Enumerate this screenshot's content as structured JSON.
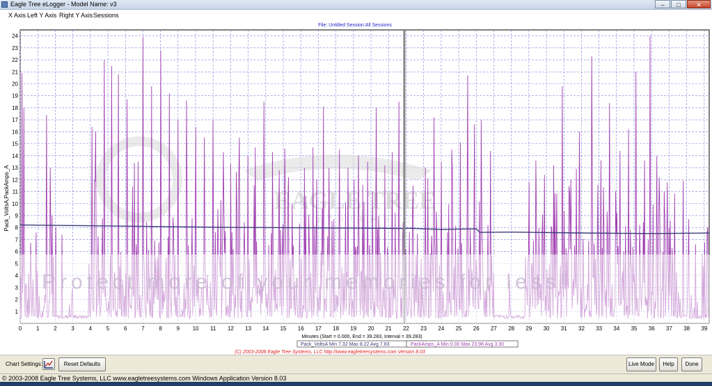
{
  "window": {
    "title": "Eagle Tree eLogger - Model Name: v3",
    "minimize": "–",
    "maximize": "□",
    "close": "✕"
  },
  "menu": [
    "X Axis",
    "Left Y Axis",
    "Right Y Axis",
    "Sessions"
  ],
  "header": {
    "file_session": "File: Untitled   Session:All Sessions"
  },
  "chart_data": {
    "type": "line",
    "ylabel": "Pack_VoltsA,PackAmps_A",
    "xlabel": "Minutes (Start = 0.000,  End = 39.283,  Interval = 39.283)",
    "x_ticks": [
      "0",
      "1",
      "2",
      "3",
      "4",
      "5",
      "6",
      "7",
      "8",
      "9",
      "10",
      "11",
      "12",
      "13",
      "14",
      "15",
      "16",
      "17",
      "18",
      "19",
      "20",
      "21",
      "22",
      "23",
      "24",
      "25",
      "26",
      "27",
      "28",
      "29",
      "30",
      "31",
      "32",
      "33",
      "34",
      "35",
      "36",
      "37",
      "38",
      "39"
    ],
    "y_ticks": [
      "1",
      "2",
      "3",
      "4",
      "5",
      "6",
      "7",
      "8",
      "9",
      "10",
      "11",
      "12",
      "13",
      "14",
      "15",
      "16",
      "17",
      "18",
      "19",
      "20",
      "21",
      "22",
      "23",
      "24"
    ],
    "xlim": [
      0,
      39.283
    ],
    "ylim": [
      0,
      24.5
    ],
    "marker_x": 21.9,
    "series": [
      {
        "name": "Pack_VoltsA",
        "color": "#3b3b7a",
        "min": "7.32",
        "max": "8.22",
        "avg": "7.83",
        "x": [
          0,
          4,
          8,
          12,
          16,
          20,
          21.9,
          22,
          24,
          26,
          26.2,
          28,
          32,
          36,
          39.283
        ],
        "values": [
          8.22,
          8.15,
          8.08,
          8.02,
          7.98,
          7.95,
          7.92,
          7.95,
          7.85,
          7.9,
          7.6,
          7.62,
          7.55,
          7.5,
          7.55
        ]
      },
      {
        "name": "PackAmps_A",
        "color": "#a040b0",
        "min": "0.00",
        "max": "23.96",
        "avg": "3.30",
        "peaks": [
          [
            0.1,
            20.9
          ],
          [
            0.2,
            18
          ],
          [
            1.5,
            17.4
          ],
          [
            1.7,
            13
          ],
          [
            4.1,
            16.4
          ],
          [
            4.3,
            16
          ],
          [
            4.8,
            22
          ],
          [
            5.2,
            21.5
          ],
          [
            5.6,
            20.8
          ],
          [
            6.1,
            18.7
          ],
          [
            6.5,
            13.4
          ],
          [
            7,
            23.9
          ],
          [
            7.5,
            19.8
          ],
          [
            8,
            22.8
          ],
          [
            8.5,
            19.2
          ],
          [
            9,
            17
          ],
          [
            9.5,
            18.6
          ],
          [
            10,
            16.4
          ],
          [
            10.5,
            15.5
          ],
          [
            11,
            17
          ],
          [
            11.6,
            14.3
          ],
          [
            12,
            13.3
          ],
          [
            12.5,
            15.5
          ],
          [
            13,
            14
          ],
          [
            13.4,
            14.7
          ],
          [
            13.9,
            18.5
          ],
          [
            14.4,
            14.3
          ],
          [
            15.1,
            14.6
          ],
          [
            15.5,
            10
          ],
          [
            16.2,
            13
          ],
          [
            16.7,
            14.7
          ],
          [
            17.3,
            18.1
          ],
          [
            17.6,
            13
          ],
          [
            18.2,
            14.5
          ],
          [
            18.7,
            13
          ],
          [
            19.3,
            14
          ],
          [
            19.8,
            13.5
          ],
          [
            20.3,
            18
          ],
          [
            20.8,
            13.2
          ],
          [
            21.2,
            14.3
          ],
          [
            21.6,
            18.5
          ],
          [
            22.4,
            11.5
          ],
          [
            23.1,
            13
          ],
          [
            23.6,
            17.2
          ],
          [
            24,
            13.5
          ],
          [
            24.6,
            14.5
          ],
          [
            25.1,
            15.1
          ],
          [
            25.5,
            20.7
          ],
          [
            25.9,
            16.6
          ],
          [
            26.3,
            17
          ],
          [
            26.8,
            14.4
          ],
          [
            29,
            11.8
          ],
          [
            29.4,
            13.6
          ],
          [
            29.9,
            12.4
          ],
          [
            30.4,
            13.2
          ],
          [
            30.9,
            19.8
          ],
          [
            31.4,
            12
          ],
          [
            31.9,
            16
          ],
          [
            32.6,
            22.3
          ],
          [
            33.1,
            13.6
          ],
          [
            33.6,
            18.4
          ],
          [
            34.2,
            14.4
          ],
          [
            34.7,
            16.2
          ],
          [
            35.1,
            21
          ],
          [
            35.6,
            13.6
          ],
          [
            35.9,
            24
          ],
          [
            36.3,
            14
          ],
          [
            36.7,
            11
          ],
          [
            37.2,
            4.5
          ],
          [
            38.1,
            8.7
          ],
          [
            38.5,
            6.6
          ],
          [
            38.9,
            5.8
          ]
        ]
      }
    ]
  },
  "legend": {
    "volts": "Pack_VoltsA   Min 7.32   Max 8.22   Avg 7.83",
    "amps": "PackAmps_A   Min 0.00   Max 23.96   Avg 3.30"
  },
  "copyright": "(C) 2003-2008 Eagle Tree Systems, LLC     http://www.eagletreesystems.com     Version 8.03",
  "watermark": {
    "logo_text": "EAGLE TREE",
    "logo_sub": "SYSTEMS",
    "overlay_text": "Protect more of your memories for less!"
  },
  "controls": {
    "chart_settings": "Chart Settings:",
    "reset_defaults": "Reset Defaults",
    "live_mode": "Live Mode",
    "help": "Help",
    "done": "Done"
  },
  "status": "© 2003-2008 Eagle Tree Systems, LLC     www.eagletreesystems.com     Windows Application Version 8.03"
}
